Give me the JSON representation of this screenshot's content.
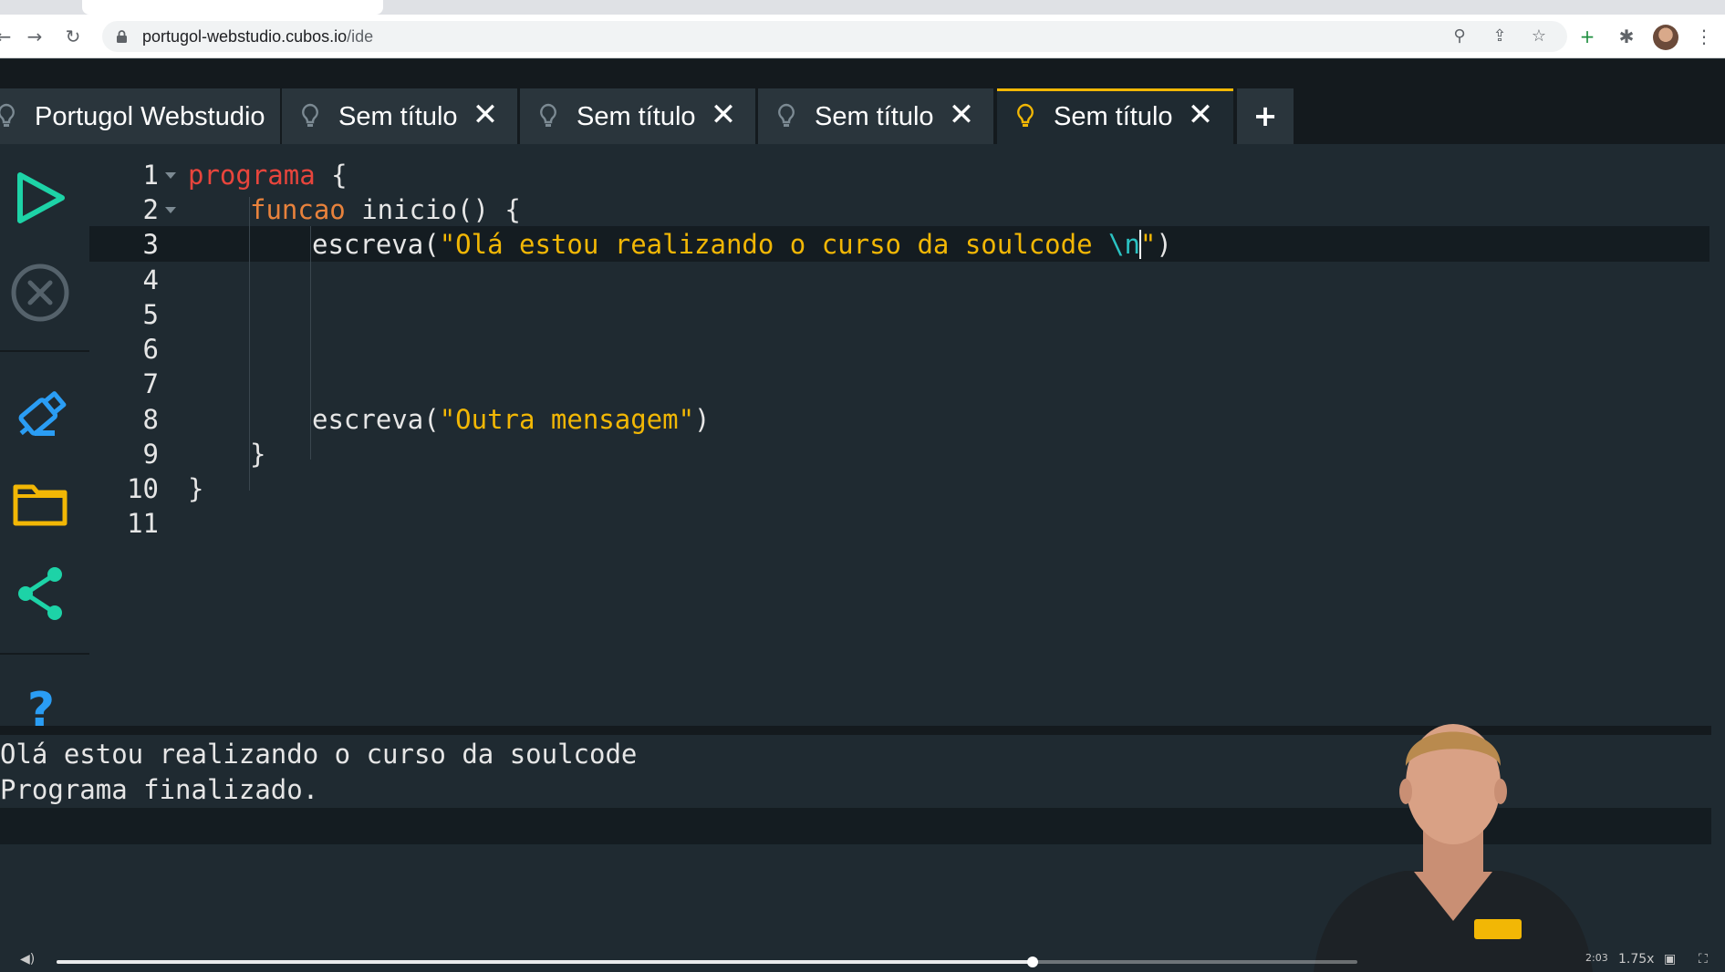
{
  "browser": {
    "url_host": "portugol-webstudio.cubos.io",
    "url_path": "/ide"
  },
  "ide": {
    "tabs": [
      {
        "label": "Portugol Webstudio",
        "closable": false,
        "active": false
      },
      {
        "label": "Sem título",
        "closable": true,
        "active": false
      },
      {
        "label": "Sem título",
        "closable": true,
        "active": false
      },
      {
        "label": "Sem título",
        "closable": true,
        "active": false
      },
      {
        "label": "Sem título",
        "closable": true,
        "active": true
      }
    ],
    "add_tab_label": "+",
    "close_glyph": "✕",
    "toolbar": [
      "play-icon",
      "stop-icon",
      "usb-drive-icon",
      "folder-icon",
      "share-icon",
      "help-icon"
    ],
    "help_glyph": "?",
    "accent_color": "#f2b705"
  },
  "code": {
    "line_numbers": [
      "1",
      "2",
      "3",
      "4",
      "5",
      "6",
      "7",
      "8",
      "9",
      "10",
      "11"
    ],
    "line1": {
      "kw": "programa",
      "rest": " {"
    },
    "line2": {
      "kw": "funcao",
      "rest": " inicio() {"
    },
    "line3": {
      "fn": "escreva(",
      "str": "\"Olá estou realizando o curso da soulcode ",
      "esc": "\\n",
      "str_end": "\"",
      "close": ")"
    },
    "line8": {
      "fn": "escreva(",
      "str": "\"Outra mensagem\"",
      "close": ")"
    },
    "line9": "}",
    "line10": "}"
  },
  "console": {
    "lines": [
      "Olá estou realizando o curso da soulcode",
      "Programa finalizado."
    ]
  },
  "player": {
    "progress": 0.75,
    "time_label": "2:03",
    "speed_label": "1.75x"
  }
}
